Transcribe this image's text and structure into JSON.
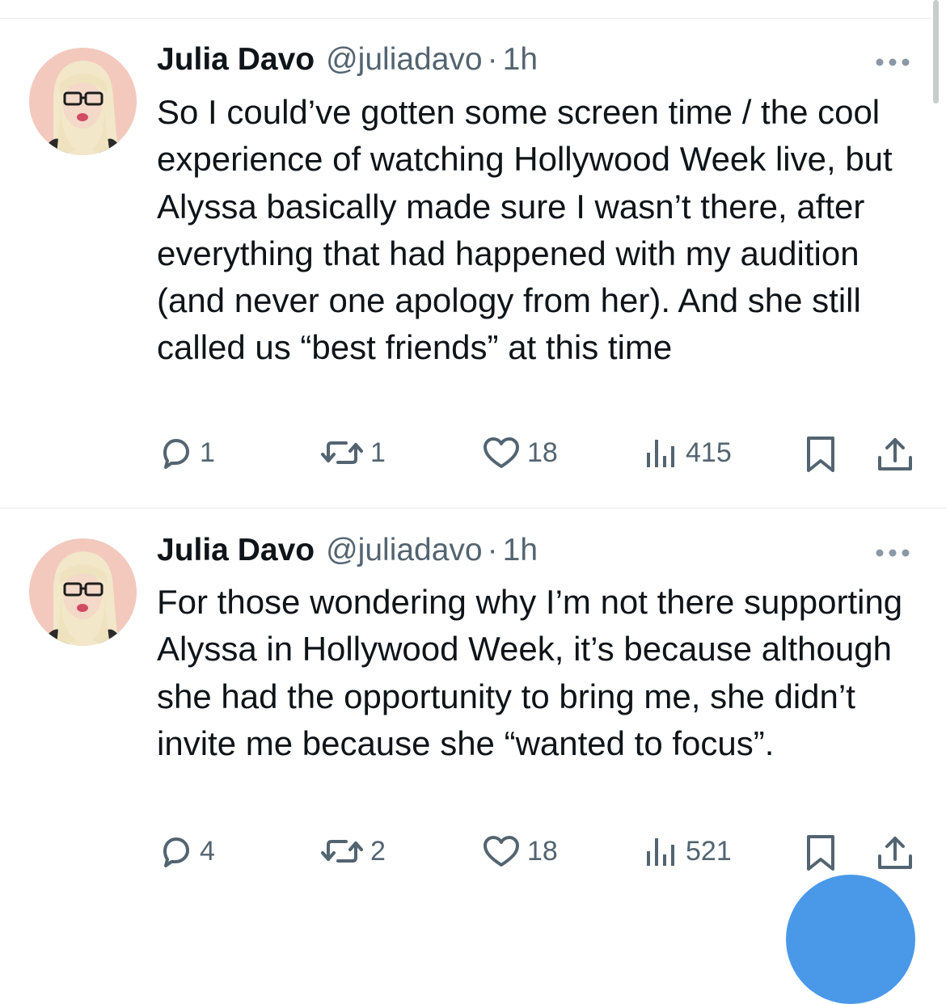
{
  "tweets": [
    {
      "author_name": "Julia Davo",
      "handle": "@juliadavo",
      "separator": "·",
      "time": "1h",
      "text": "So I could’ve gotten some screen time / the cool experience of watching Hollywood Week live, but Alyssa basically made sure I wasn’t there, after everything that had happened with my audition (and never one apology from her). And she still called us “best friends” at this time",
      "replies": "1",
      "reposts": "1",
      "likes": "18",
      "views": "415"
    },
    {
      "author_name": "Julia Davo",
      "handle": "@juliadavo",
      "separator": "·",
      "time": "1h",
      "text": "For those wondering why I’m not there supporting Alyssa in Hollywood Week, it’s because although she had the opportunity to bring me, she didn’t invite me because she “wanted to focus”.",
      "replies": "4",
      "reposts": "2",
      "likes": "18",
      "views": "521"
    }
  ],
  "icons": {
    "reply": "reply-icon",
    "repost": "repost-icon",
    "like": "heart-icon",
    "views": "views-icon",
    "bookmark": "bookmark-icon",
    "share": "share-icon",
    "more": "more-icon"
  },
  "colors": {
    "text": "#0f1419",
    "secondary": "#536471",
    "divider": "#e6e9ec",
    "fab": "#4a99e9"
  }
}
